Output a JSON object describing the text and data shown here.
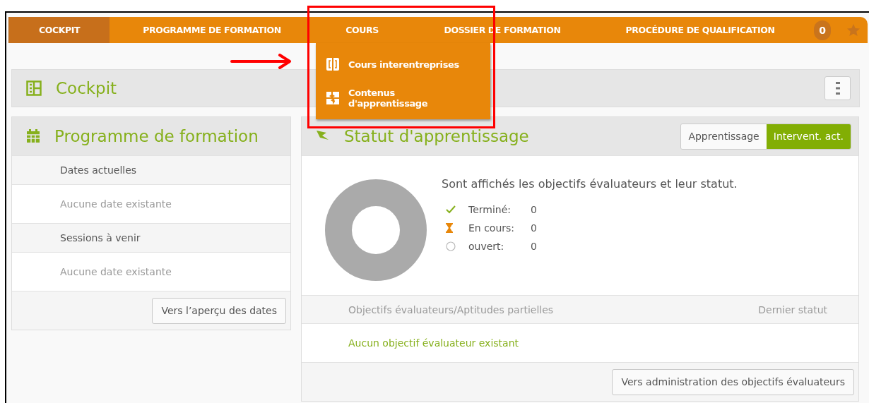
{
  "nav": {
    "tabs": [
      {
        "label": "COCKPIT",
        "selected": true
      },
      {
        "label": "PROGRAMME DE FORMATION",
        "selected": false
      },
      {
        "label": "COURS",
        "selected": false
      },
      {
        "label": "DOSSIER DE FORMATION",
        "selected": false
      },
      {
        "label": "PROCÉDURE DE QUALIFICATION",
        "selected": false
      }
    ],
    "counter": "0",
    "dropdown": {
      "items": [
        {
          "kind": "courses",
          "label": "Cours interentreprises"
        },
        {
          "kind": "contents",
          "label": "Contenus d'apprentissage"
        }
      ]
    }
  },
  "cockpit": {
    "title": "Cockpit"
  },
  "program": {
    "title": "Programme de formation",
    "rows": [
      {
        "kind": "heading",
        "text": "Dates actuelles"
      },
      {
        "kind": "empty",
        "text": "Aucune date existante"
      },
      {
        "kind": "heading",
        "text": "Sessions à venir"
      },
      {
        "kind": "empty",
        "text": "Aucune date existante"
      }
    ],
    "button": "Vers l’aperçu des dates"
  },
  "status": {
    "title": "Statut d'apprentissage",
    "toggle": [
      {
        "label": "Apprentissage",
        "selected": false
      },
      {
        "label": "Intervent. act.",
        "selected": true
      }
    ],
    "description": "Sont affichés les objectifs évaluateurs et leur statut.",
    "legend": [
      {
        "kind": "done",
        "label": "Terminé:",
        "value": "0"
      },
      {
        "kind": "in_progress",
        "label": "En cours:",
        "value": "0"
      },
      {
        "kind": "open",
        "label": "ouvert:",
        "value": "0"
      }
    ],
    "table": {
      "columns": [
        "Objectifs évaluateurs/Aptitudes partielles",
        "Dernier statut"
      ],
      "empty": "Aucun objectif évaluateur existant"
    },
    "button": "Vers administration des objectifs évaluateurs"
  }
}
